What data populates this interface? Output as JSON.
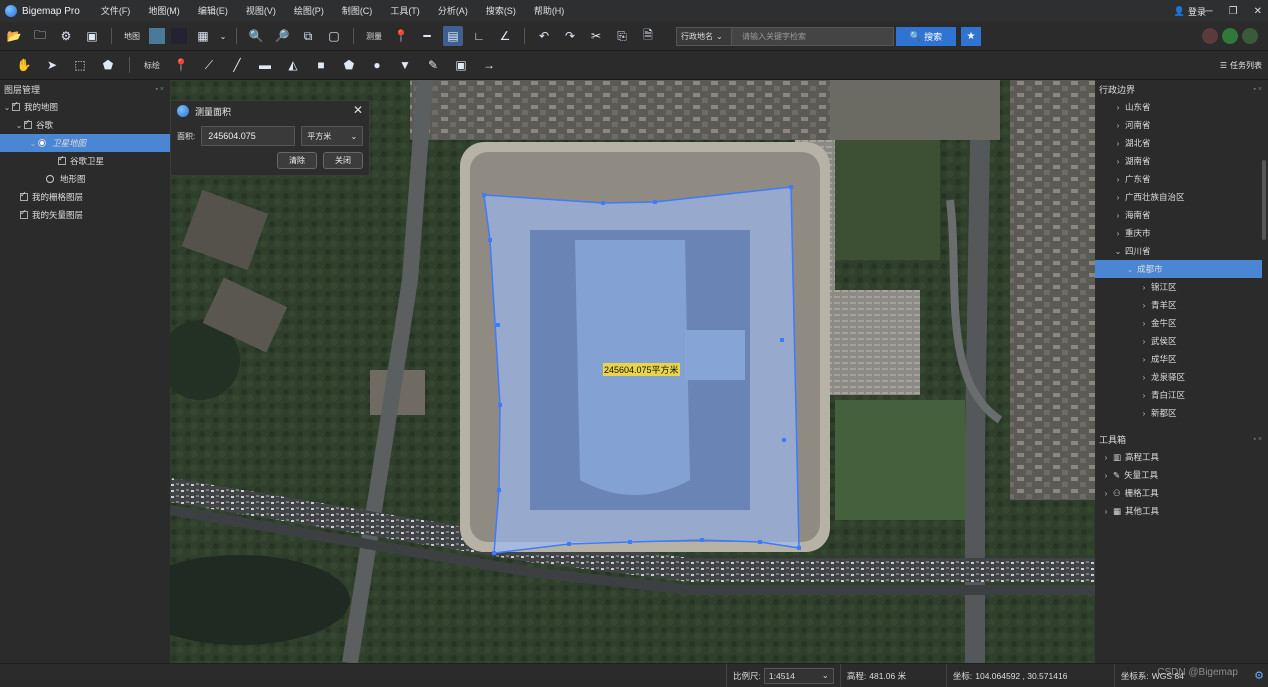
{
  "app": {
    "title": "Bigemap Pro",
    "menu": [
      "文件(F)",
      "地图(M)",
      "编辑(E)",
      "视图(V)",
      "绘图(P)",
      "制图(C)",
      "工具(T)",
      "分析(A)",
      "搜索(S)",
      "帮助(H)"
    ],
    "login_label": "登录"
  },
  "toolbar1": {
    "map_label": "地图",
    "measure_label": "测量",
    "search": {
      "type_selected": "行政地名",
      "placeholder": "请输入关键字检索",
      "button_label": "搜索"
    }
  },
  "toolbar2": {
    "annotate_label": "标绘",
    "tasklist_label": "任务列表"
  },
  "layer_panel": {
    "title": "图层管理",
    "items": [
      {
        "label": "我的地图"
      },
      {
        "label": "谷歌"
      },
      {
        "label": "卫星地图"
      },
      {
        "label": "谷歌卫星"
      },
      {
        "label": "地形图"
      },
      {
        "label": "我的栅格图层"
      },
      {
        "label": "我的矢量图层"
      }
    ]
  },
  "measure_dialog": {
    "title": "测量面积",
    "area_label": "面积:",
    "area_value": "245604.075",
    "unit": "平方米",
    "clear_label": "清除",
    "close_label": "关闭"
  },
  "map": {
    "measure_result_label": "245604.075平方米"
  },
  "admin_panel": {
    "title": "行政边界",
    "provinces": [
      "山东省",
      "河南省",
      "湖北省",
      "湖南省",
      "广东省",
      "广西壮族自治区",
      "海南省",
      "重庆市",
      "四川省"
    ],
    "city": "成都市",
    "districts": [
      "锦江区",
      "青羊区",
      "金牛区",
      "武侯区",
      "成华区",
      "龙泉驿区",
      "青白江区",
      "新都区"
    ]
  },
  "toolbox": {
    "title": "工具箱",
    "items": [
      "高程工具",
      "矢量工具",
      "栅格工具",
      "其他工具"
    ]
  },
  "statusbar": {
    "scale_label": "比例尺:",
    "scale_value": "1:4514",
    "elevation_label": "高程:",
    "elevation_value": "481.06 米",
    "coord_label": "坐标:",
    "coord_value": "104.064592 , 30.571416",
    "crs_label": "坐标系:",
    "crs_value": "WGS 84",
    "watermark": "CSDN @Bigemap"
  },
  "colors": {
    "accent": "#2f74d0",
    "selection": "#4a86d4",
    "measure_fill": "#9cc0ff",
    "measure_stroke": "#3e7bff"
  }
}
